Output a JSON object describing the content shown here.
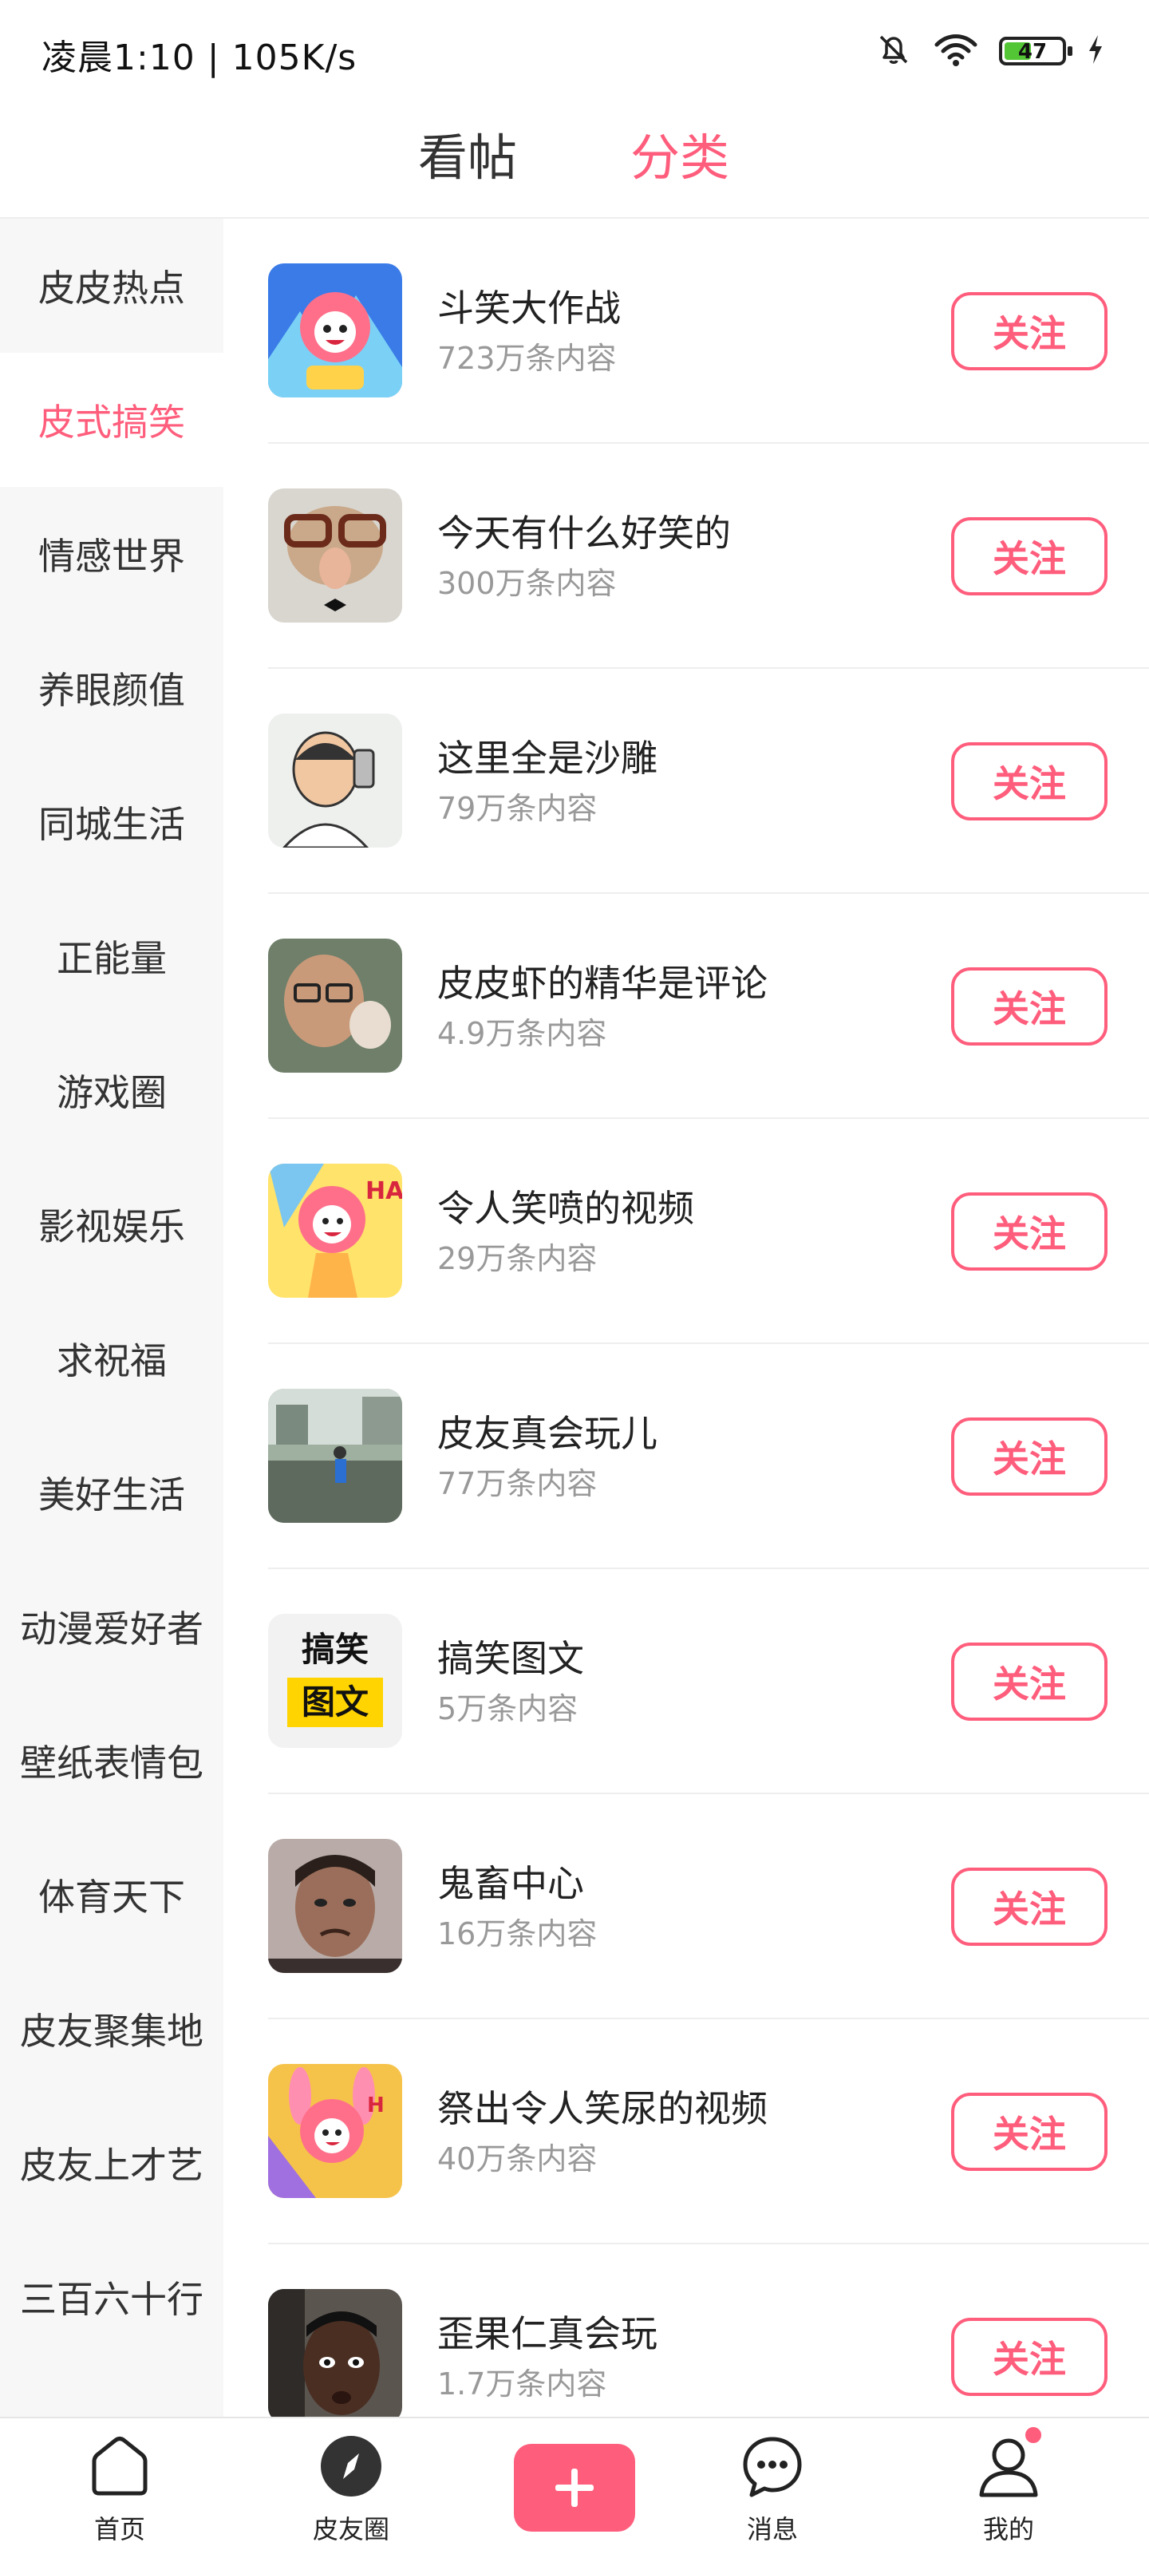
{
  "status_bar": {
    "time_speed": "凌晨1:10 | 105K/s",
    "battery": "47",
    "icons": [
      "mute-bell-icon",
      "wifi-icon",
      "battery-icon",
      "charging-icon"
    ]
  },
  "top_tabs": [
    {
      "label": "看帖",
      "active": false
    },
    {
      "label": "分类",
      "active": true
    }
  ],
  "colors": {
    "accent": "#ff5d7c",
    "muted_text": "#999999",
    "sidebar_bg": "#f7f7f7"
  },
  "sidebar": {
    "items": [
      {
        "label": "皮皮热点"
      },
      {
        "label": "皮式搞笑",
        "active": true
      },
      {
        "label": "情感世界"
      },
      {
        "label": "养眼颜值"
      },
      {
        "label": "同城生活"
      },
      {
        "label": "正能量"
      },
      {
        "label": "游戏圈"
      },
      {
        "label": "影视娱乐"
      },
      {
        "label": "求祝福"
      },
      {
        "label": "美好生活"
      },
      {
        "label": "动漫爱好者"
      },
      {
        "label": "壁纸表情包"
      },
      {
        "label": "体育天下"
      },
      {
        "label": "皮友聚集地"
      },
      {
        "label": "皮友上才艺"
      },
      {
        "label": "三百六十行"
      }
    ]
  },
  "topics": {
    "follow_label": "关注",
    "items": [
      {
        "title": "斗笑大作战",
        "count": "723万条内容",
        "thumb": "cartoon-mascot-blue"
      },
      {
        "title": "今天有什么好笑的",
        "count": "300万条内容",
        "thumb": "glasses-nose-face"
      },
      {
        "title": "这里全是沙雕",
        "count": "79万条内容",
        "thumb": "selfie-meme"
      },
      {
        "title": "皮皮虾的精华是评论",
        "count": "4.9万条内容",
        "thumb": "man-photo"
      },
      {
        "title": "令人笑喷的视频",
        "count": "29万条内容",
        "thumb": "cartoon-mascot-yellow"
      },
      {
        "title": "皮友真会玩儿",
        "count": "77万条内容",
        "thumb": "outdoor-photo"
      },
      {
        "title": "搞笑图文",
        "count": "5万条内容",
        "thumb": "text-logo",
        "thumb_text": [
          "搞笑",
          "图文"
        ]
      },
      {
        "title": "鬼畜中心",
        "count": "16万条内容",
        "thumb": "face-photo"
      },
      {
        "title": "祭出令人笑尿的视频",
        "count": "40万条内容",
        "thumb": "cartoon-mascot-pink"
      },
      {
        "title": "歪果仁真会玩",
        "count": "1.7万条内容",
        "thumb": "face-photo-dark"
      }
    ]
  },
  "bottom_nav": [
    {
      "label": "首页",
      "icon": "home-icon"
    },
    {
      "label": "皮友圈",
      "icon": "compass-icon"
    },
    {
      "label": "",
      "icon": "plus-icon"
    },
    {
      "label": "消息",
      "icon": "message-icon"
    },
    {
      "label": "我的",
      "icon": "user-icon",
      "badge": true
    }
  ]
}
